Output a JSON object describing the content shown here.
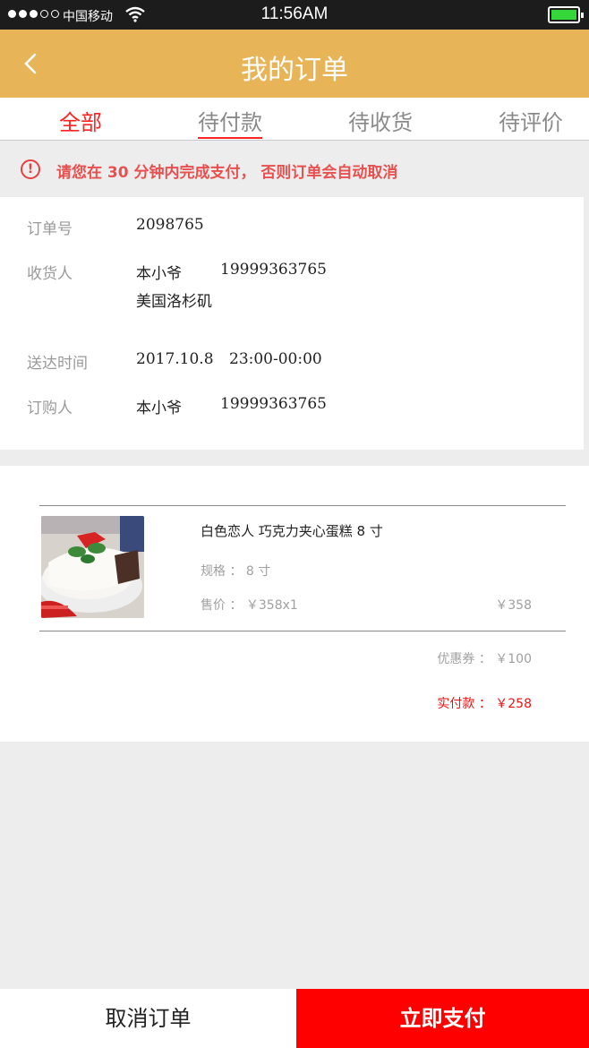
{
  "status_bar": {
    "carrier": "中国移动",
    "time": "11:56AM"
  },
  "header": {
    "title": "我的订单"
  },
  "tabs": [
    {
      "label": "全部",
      "active": true
    },
    {
      "label": "待付款",
      "active": false
    },
    {
      "label": "待收货",
      "active": false
    },
    {
      "label": "待评价",
      "active": false
    }
  ],
  "notice": {
    "text": "请您在 30 分钟内完成支付， 否则订单会自动取消"
  },
  "order": {
    "order_no_label": "订单号",
    "order_no": "2098765",
    "receiver_label": "收货人",
    "receiver_name": "本小爷",
    "receiver_phone": "19999363765",
    "receiver_address": "美国洛杉矶",
    "delivery_label": "送达时间",
    "delivery_date": "2017.10.8",
    "delivery_time": "23:00-00:00",
    "buyer_label": "订购人",
    "buyer_name": "本小爷",
    "buyer_phone": "19999363765"
  },
  "product": {
    "name": "白色恋人  巧克力夹心蛋糕  8 寸",
    "spec": "规格 ： 8 寸",
    "price": "售价 ： ￥358x1",
    "total": "￥358",
    "coupon": "优惠券 ： ￥100",
    "paid": "实付款 ： ￥258"
  },
  "actions": {
    "cancel": "取消订单",
    "pay": "立即支付"
  },
  "colors": {
    "header": "#e8b458",
    "accent": "#ff0000",
    "notice": "#e85050"
  }
}
